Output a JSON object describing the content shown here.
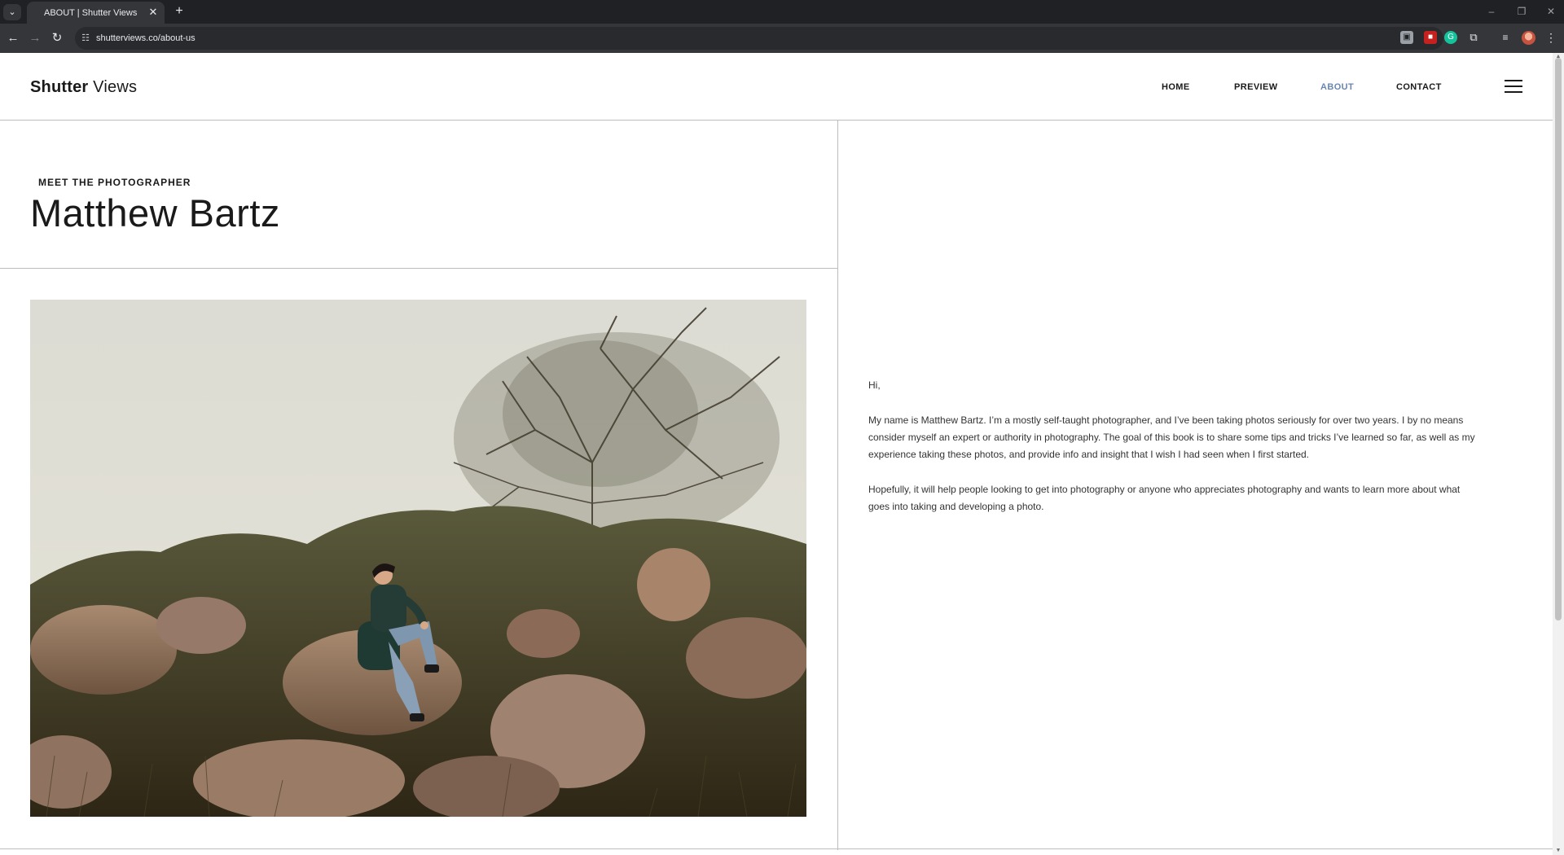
{
  "browser": {
    "tab_title": "ABOUT | Shutter Views",
    "tab_close": "✕",
    "new_tab": "+",
    "url": "shutterviews.co/about-us",
    "window_controls": {
      "minimize": "–",
      "restore": "❐",
      "close": "✕"
    },
    "toolbar_icons": [
      "back-icon",
      "forward-icon",
      "reload-icon",
      "site-info-icon",
      "bookmark-star-icon",
      "extensions-icon",
      "media-controls-icon",
      "profile-avatar",
      "more-menu-icon"
    ]
  },
  "site": {
    "logo_bold": "Shutter",
    "logo_light": "Views",
    "nav": [
      {
        "label": "HOME",
        "active": false
      },
      {
        "label": "PREVIEW",
        "active": false
      },
      {
        "label": "ABOUT",
        "active": true
      },
      {
        "label": "CONTACT",
        "active": false
      }
    ],
    "accent_color": "#6b86ae"
  },
  "hero": {
    "kicker": "MEET THE PHOTOGRAPHER",
    "name": "Matthew Bartz"
  },
  "bio": {
    "greeting": "Hi,",
    "paragraph_1": "My name is Matthew Bartz. I’m a mostly self-taught photographer, and I’ve been taking photos seriously for over two years. I by no means consider myself an expert or authority in photography. The goal of this book is to share some tips and tricks I’ve learned so far, as well as my experience taking these photos, and provide info and insight that I wish I had seen when I first started.",
    "paragraph_2": "Hopefully, it will help people looking to get into photography or anyone who appreciates photography and wants to learn more about what goes into taking and developing a photo."
  }
}
